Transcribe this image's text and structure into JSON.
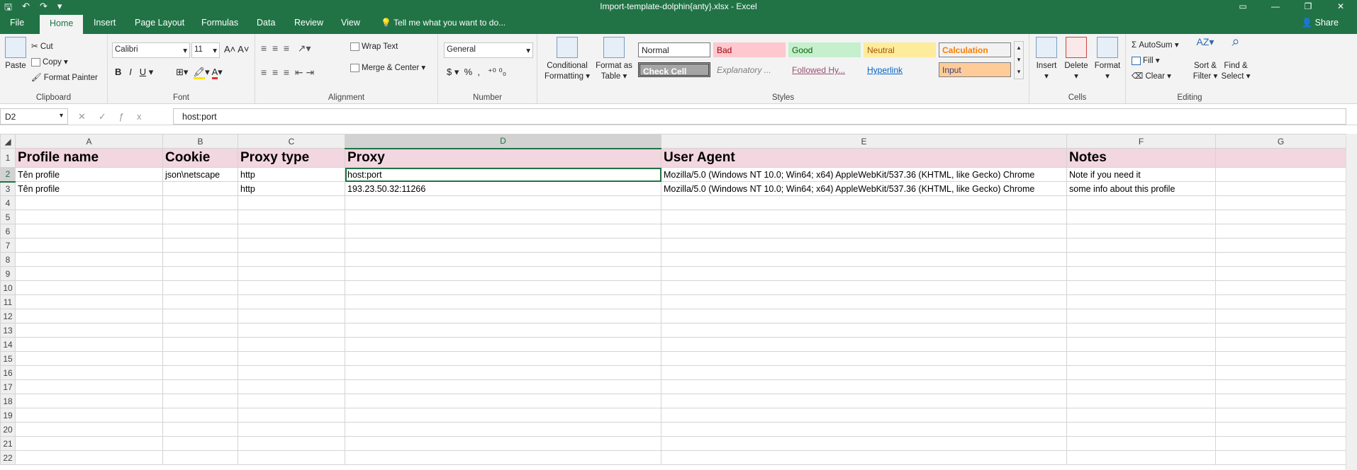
{
  "window": {
    "title": "Import-template-dolphin{anty}.xlsx - Excel"
  },
  "tabs": [
    "File",
    "Home",
    "Insert",
    "Page Layout",
    "Formulas",
    "Data",
    "Review",
    "View"
  ],
  "tell_me": "Tell me what you want to do...",
  "share": "Share",
  "clipboard": {
    "paste": "Paste",
    "cut": "Cut",
    "copy": "Copy",
    "format_painter": "Format Painter",
    "label": "Clipboard"
  },
  "font": {
    "name": "Calibri",
    "size": "11",
    "label": "Font"
  },
  "alignment": {
    "wrap": "Wrap Text",
    "merge": "Merge & Center",
    "label": "Alignment"
  },
  "number": {
    "format": "General",
    "label": "Number"
  },
  "styles": {
    "conditional": "Conditional",
    "formatting": "Formatting",
    "format_as": "Format as",
    "table": "Table",
    "normal": "Normal",
    "bad": "Bad",
    "good": "Good",
    "neutral": "Neutral",
    "calculation": "Calculation",
    "check_cell": "Check Cell",
    "explanatory": "Explanatory ...",
    "followed": "Followed Hy...",
    "hyperlink": "Hyperlink",
    "input": "Input",
    "label": "Styles"
  },
  "cells": {
    "insert": "Insert",
    "delete": "Delete",
    "format": "Format",
    "label": "Cells"
  },
  "editing": {
    "autosum": "AutoSum",
    "fill": "Fill",
    "clear": "Clear",
    "sort": "Sort &",
    "filter": "Filter",
    "find": "Find &",
    "select": "Select",
    "label": "Editing"
  },
  "formula_bar": {
    "name_box": "D2",
    "value": "host:port"
  },
  "columns": [
    "A",
    "B",
    "C",
    "D",
    "E",
    "F",
    "G"
  ],
  "rows": [
    [
      "Profile name",
      "Cookie",
      "Proxy type",
      "Proxy",
      "User Agent",
      "Notes",
      ""
    ],
    [
      "Tên profile",
      "json\\netscape",
      "http",
      "host:port",
      "Mozilla/5.0 (Windows NT 10.0; Win64; x64) AppleWebKit/537.36 (KHTML, like Gecko) Chrome",
      "Note if you need it",
      ""
    ],
    [
      "Tên profile",
      "",
      "http",
      "193.23.50.32:11266",
      "Mozilla/5.0 (Windows NT 10.0; Win64; x64) AppleWebKit/537.36 (KHTML, like Gecko) Chrome",
      "some info about this profile",
      ""
    ]
  ],
  "row_count": 22,
  "colors": {
    "brand": "#217346",
    "header_fill": "#f2d6e0"
  }
}
